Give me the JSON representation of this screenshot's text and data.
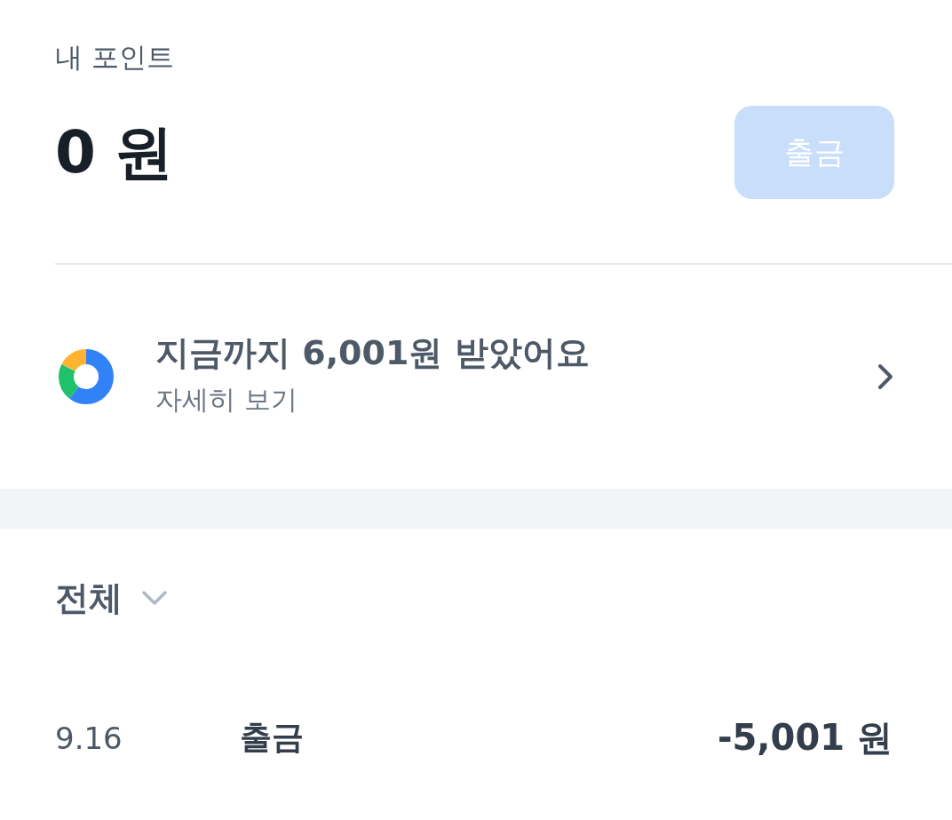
{
  "points": {
    "label": "내 포인트",
    "amount": "0 원",
    "withdraw_button": {
      "label": "출금",
      "disabled": true
    }
  },
  "summary": {
    "title": "지금까지 6,001원 받았어요",
    "link": "자세히 보기"
  },
  "filter": {
    "label": "전체"
  },
  "transactions": [
    {
      "date": "9.16",
      "type": "출금",
      "amount": "-5,001 원"
    }
  ]
}
